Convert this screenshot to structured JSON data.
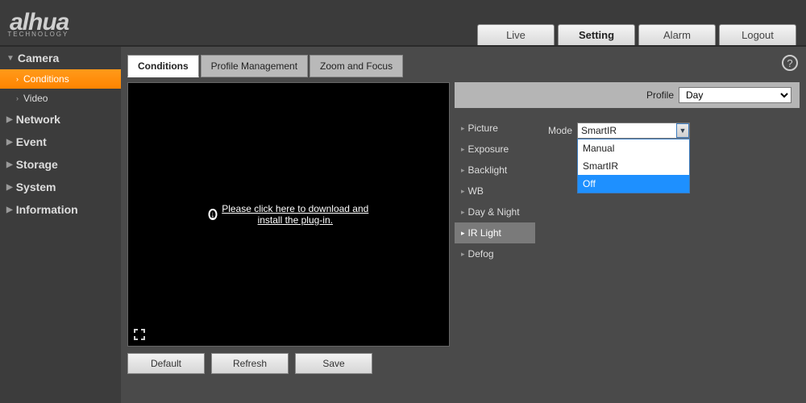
{
  "brand": {
    "name": "alhua",
    "sub": "TECHNOLOGY"
  },
  "topnav": {
    "live": "Live",
    "setting": "Setting",
    "alarm": "Alarm",
    "logout": "Logout"
  },
  "sidebar": {
    "main": [
      "Camera",
      "Network",
      "Event",
      "Storage",
      "System",
      "Information"
    ],
    "camera_sub": [
      "Conditions",
      "Video"
    ]
  },
  "tabs": {
    "conditions": "Conditions",
    "profile_mgmt": "Profile Management",
    "zoom_focus": "Zoom and Focus"
  },
  "plugin_msg": "Please click here to download and install the plug-in.",
  "profile": {
    "label": "Profile",
    "value": "Day"
  },
  "settings_list": [
    "Picture",
    "Exposure",
    "Backlight",
    "WB",
    "Day & Night",
    "IR Light",
    "Defog"
  ],
  "mode": {
    "label": "Mode",
    "value": "SmartIR",
    "options": [
      "Manual",
      "SmartIR",
      "Off"
    ],
    "hovered": "Off"
  },
  "buttons": {
    "default": "Default",
    "refresh": "Refresh",
    "save": "Save"
  }
}
